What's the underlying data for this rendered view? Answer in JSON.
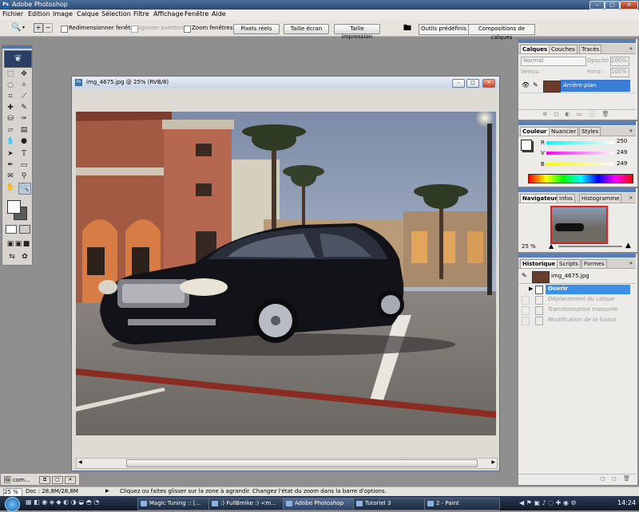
{
  "app": {
    "title": "Adobe Photoshop"
  },
  "menu": [
    "Fichier",
    "Edition",
    "Image",
    "Calque",
    "Sélection",
    "Filtre",
    "Affichage",
    "Fenêtre",
    "Aide"
  ],
  "options": {
    "resize_windows": "Redimensionner fenêtres",
    "ignore_palettes": "Ignorer palettes",
    "zoom_windows": "Zoom fenêtres",
    "actual_pixels": "Pixels réels",
    "fit_screen": "Taille écran",
    "print_size": "Taille impression",
    "presets_tab": "Outils prédéfinis",
    "comps_tab": "Compositions de calques"
  },
  "document": {
    "title": "img_4675.jpg @ 25% (RVB/8)",
    "zoom": "25 %",
    "doc_size": "Doc : 28,8M/28,8M",
    "minimized_label": "com..."
  },
  "layers_panel": {
    "tabs": [
      "Calques",
      "Couches",
      "Tracés"
    ],
    "blend_mode": "Normal",
    "opacity_label": "Opacité :",
    "opacity": "100%",
    "lock_label": "Verrou :",
    "fill_label": "Fond :",
    "fill": "100%",
    "layer_name": "Arrière-plan"
  },
  "color_panel": {
    "tabs": [
      "Couleur",
      "Nuancier",
      "Styles"
    ],
    "r_label": "R",
    "r": "250",
    "g_label": "V",
    "g": "249",
    "b_label": "B",
    "b": "249"
  },
  "navigator_panel": {
    "tabs": [
      "Navigateur",
      "Infos",
      "Histogramme"
    ],
    "zoom": "25 %"
  },
  "history_panel": {
    "tabs": [
      "Historique",
      "Scripts",
      "Formes"
    ],
    "snapshot": "img_4675.jpg",
    "items": [
      "Ouvrir",
      "Déplacement du calque",
      "Transformation manuelle",
      "Modification de la fusion"
    ]
  },
  "status": {
    "message": "Cliquez ou faites glisser sur la zone à agrandir. Changez l'état du zoom dans la barre d'options."
  },
  "taskbar": {
    "tasks": [
      "Magic Tuning :: [...",
      ":) FullBmike :) <m...",
      "Adobe Photoshop",
      "Tutoriel 3",
      "2 - Paint"
    ],
    "clock": "14:24"
  },
  "colors": {
    "accent": "#3a7bd5",
    "history_selected": "#3d8fe6",
    "title_bar": "#3b5b86"
  }
}
